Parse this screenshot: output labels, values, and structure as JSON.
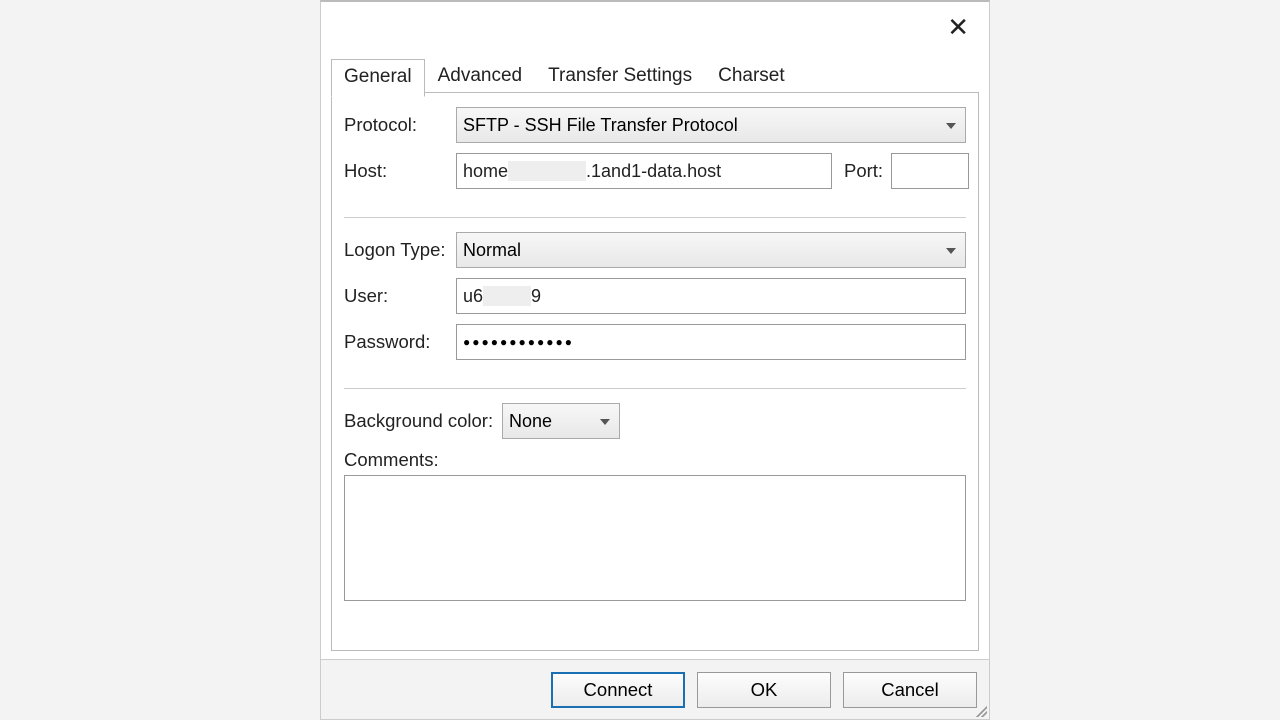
{
  "dialog": {
    "close_icon": "✕"
  },
  "tabs": [
    {
      "label": "General",
      "active": true
    },
    {
      "label": "Advanced",
      "active": false
    },
    {
      "label": "Transfer Settings",
      "active": false
    },
    {
      "label": "Charset",
      "active": false
    }
  ],
  "general": {
    "protocol_label": "Protocol:",
    "protocol_value": "SFTP - SSH File Transfer Protocol",
    "host_label": "Host:",
    "host_prefix": "home",
    "host_suffix": ".1and1-data.host",
    "port_label": "Port:",
    "port_value": "",
    "logon_type_label": "Logon Type:",
    "logon_type_value": "Normal",
    "user_label": "User:",
    "user_prefix": "u6",
    "user_suffix": "9",
    "password_label": "Password:",
    "password_value": "●●●●●●●●●●●●",
    "bgcolor_label": "Background color:",
    "bgcolor_value": "None",
    "comments_label": "Comments:",
    "comments_value": ""
  },
  "buttons": {
    "connect": "Connect",
    "ok": "OK",
    "cancel": "Cancel"
  }
}
